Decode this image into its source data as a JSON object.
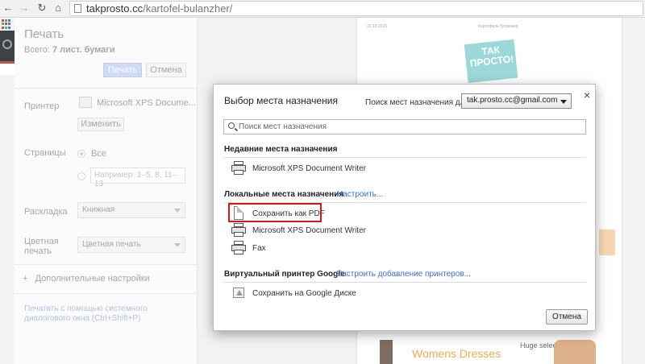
{
  "browser": {
    "url_host": "takprosto.cc",
    "url_path": "/kartofel-bulanzher/"
  },
  "print_panel": {
    "title": "Печать",
    "total_label": "Всего:",
    "total_value": "7 лист. бумаги",
    "print_button": "Печать",
    "cancel_button": "Отмена",
    "printer_label": "Принтер",
    "printer_name": "Microsoft XPS Docume...",
    "change_button": "Изменить",
    "pages_label": "Страницы",
    "pages_all": "Все",
    "pages_placeholder": "Например: 1–5, 8, 11–13",
    "layout_label": "Раскладка",
    "layout_value": "Книжная",
    "color_label": "Цветная печать",
    "color_value": "Цветная печать",
    "more_settings": "Дополнительные настройки",
    "system_dialog": "Печатать с помощью системного диалогового окна (Ctrl+Shift+P)"
  },
  "preview": {
    "header_date": "22.10.2015",
    "header_title": "Картофель булан­жер",
    "logo_text": "ТАК ПРОСТО!",
    "ad_text": "Womens Dresses",
    "ad_small": "Huge selection. Li..."
  },
  "dialog": {
    "title": "Выбор места назначения",
    "close_icon": "×",
    "search_label": "Поиск мест назначения для",
    "account": "tak.prosto.cc@gmail.com",
    "search_placeholder": "Поиск мест назначения",
    "recent_title": "Недавние места назначения",
    "recent_items": [
      "Microsoft XPS Document Writer"
    ],
    "local_title": "Локальные места назначения",
    "local_link": "Настроить...",
    "local_items": [
      "Сохранить как PDF",
      "Microsoft XPS Document Writer",
      "Fax"
    ],
    "google_title": "Виртуальный принтер Google",
    "google_link": "Настроить добавление принтеров...",
    "google_items": [
      "Сохранить на Google Диске"
    ],
    "cancel_button": "Отмена"
  },
  "colors": {
    "highlight": "#d01818",
    "link": "#3a6fc3",
    "print_button_bg": "#c8d7f2"
  }
}
